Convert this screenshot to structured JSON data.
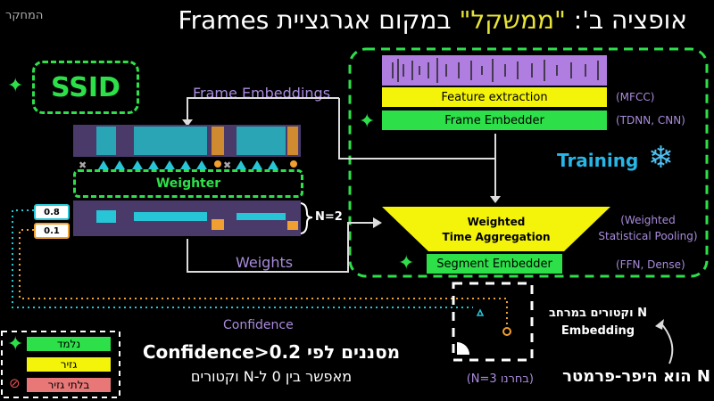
{
  "title": {
    "prefix": "אופציה ב': ",
    "highlight": "\"ממשקל\"",
    "suffix": " במקום אגרגציית Frames"
  },
  "corner_label": "המחקר",
  "ssid": "SSID",
  "labels": {
    "frame_embeddings": "Frame Embeddings",
    "weighter": "Weighter",
    "weights": "Weights",
    "confidence": "Confidence",
    "n_eq_2": "N=2",
    "training": "Training"
  },
  "weights_values": [
    "0.8",
    "0.1"
  ],
  "pipeline": {
    "feature_extraction": "Feature extraction",
    "feature_extraction_note": "(MFCC)",
    "frame_embedder": "Frame Embedder",
    "frame_embedder_note": "(TDNN, CNN)",
    "weighted_agg_line1": "Weighted",
    "weighted_agg_line2": "Time Aggregation",
    "weighted_agg_note_line1": "(Weighted",
    "weighted_agg_note_line2": "Statistical Pooling)",
    "segment_embedder": "Segment Embedder",
    "segment_embedder_note": "(FFN, Dense)"
  },
  "right_notes": {
    "n_vectors_line1": "N וקטורים במרחב",
    "n_vectors_line2": "Embedding",
    "n_hyper": "N הוא היפר-פרמטר",
    "n_chosen": "(בחרנו N=3)"
  },
  "legend": {
    "learned": "נלמד",
    "derived": "גזיר",
    "non_derived": "בלתי גזיר"
  },
  "bottom_text": {
    "line1": "מסננים לפי Confidence>0.2",
    "line2": "מאפשר בין 0 ל-N וקטורים"
  },
  "colors": {
    "green": "#2de04a",
    "yellow": "#f4f40a",
    "salmon": "#e87878",
    "purple": "#a98bdc",
    "cyan": "#27c6d6",
    "orange": "#f0a030"
  }
}
